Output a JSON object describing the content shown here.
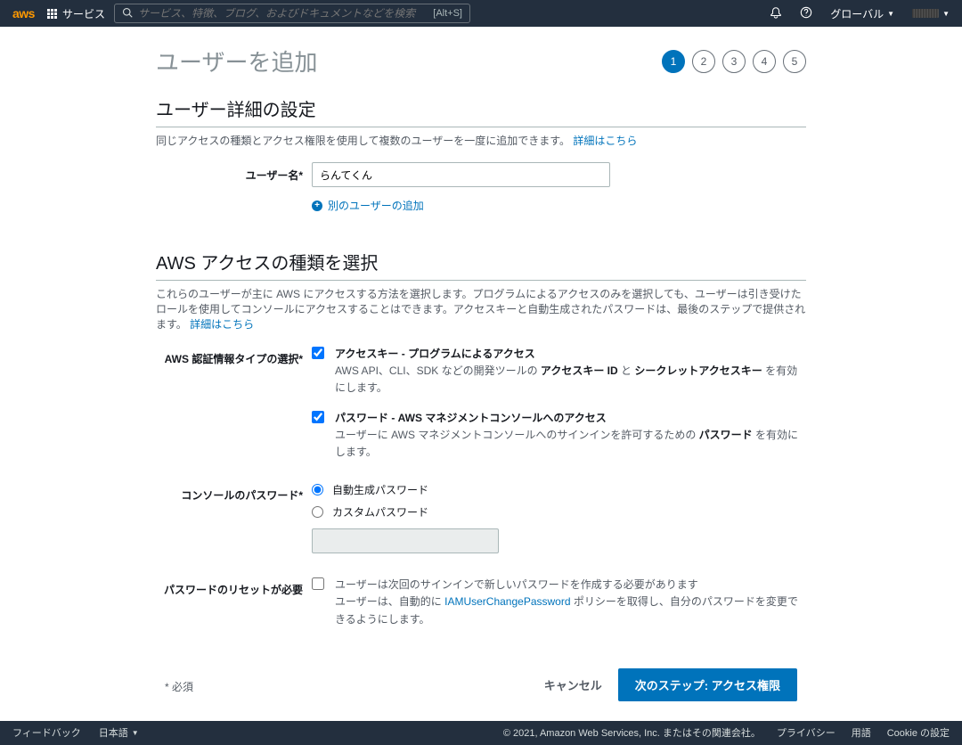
{
  "header": {
    "logo": "aws",
    "services": "サービス",
    "search_placeholder": "サービス、特徴、ブログ、およびドキュメントなどを検索",
    "search_kbd": "[Alt+S]",
    "region": "グローバル"
  },
  "page": {
    "title": "ユーザーを追加",
    "steps": [
      "1",
      "2",
      "3",
      "4",
      "5"
    ]
  },
  "user_details": {
    "heading": "ユーザー詳細の設定",
    "desc": "同じアクセスの種類とアクセス権限を使用して複数のユーザーを一度に追加できます。",
    "more": "詳細はこちら",
    "username_label": "ユーザー名*",
    "username_value": "らんてくん",
    "add_another": "別のユーザーの追加"
  },
  "access_type": {
    "heading": "AWS アクセスの種類を選択",
    "desc": "これらのユーザーが主に AWS にアクセスする方法を選択します。プログラムによるアクセスのみを選択しても、ユーザーは引き受けたロールを使用してコンソールにアクセスすることはできます。アクセスキーと自動生成されたパスワードは、最後のステップで提供されます。",
    "more": "詳細はこちら",
    "cred_label": "AWS 認証情報タイプの選択*",
    "opt1_title": "アクセスキー - プログラムによるアクセス",
    "opt1_desc_pre": "AWS API、CLI、SDK などの開発ツールの ",
    "opt1_bold1": "アクセスキー ID",
    "opt1_mid": " と ",
    "opt1_bold2": "シークレットアクセスキー",
    "opt1_desc_post": " を有効にします。",
    "opt2_title": "パスワード - AWS マネジメントコンソールへのアクセス",
    "opt2_desc_pre": "ユーザーに AWS マネジメントコンソールへのサインインを許可するための ",
    "opt2_bold": "パスワード",
    "opt2_desc_post": " を有効にします。",
    "console_pw_label": "コンソールのパスワード*",
    "auto_pw": "自動生成パスワード",
    "custom_pw": "カスタムパスワード",
    "reset_label": "パスワードのリセットが必要",
    "reset_desc1": "ユーザーは次回のサインインで新しいパスワードを作成する必要があります",
    "reset_desc2_pre": "ユーザーは、自動的に ",
    "reset_policy": "IAMUserChangePassword",
    "reset_desc2_post": " ポリシーを取得し、自分のパスワードを変更できるようにします。"
  },
  "footer_actions": {
    "required": "* 必須",
    "cancel": "キャンセル",
    "next": "次のステップ: アクセス権限"
  },
  "footer": {
    "feedback": "フィードバック",
    "language": "日本語",
    "copyright": "© 2021, Amazon Web Services, Inc. またはその関連会社。",
    "privacy": "プライバシー",
    "terms": "用語",
    "cookie": "Cookie の設定"
  }
}
